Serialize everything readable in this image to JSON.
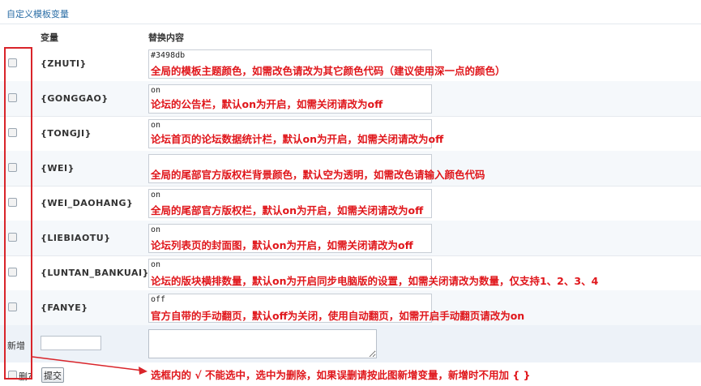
{
  "panel": {
    "title": "自定义模板变量",
    "col_variable": "变量",
    "col_replace": "替换内容"
  },
  "rows": [
    {
      "variable": "{ZHUTI}",
      "value": "#3498db",
      "note": "全局的模板主题颜色，如需改色请改为其它颜色代码（建议使用深一点的颜色）"
    },
    {
      "variable": "{GONGGAO}",
      "value": "on",
      "note": "论坛的公告栏，默认on为开启，如需关闭请改为off"
    },
    {
      "variable": "{TONGJI}",
      "value": "on",
      "note": "论坛首页的论坛数据统计栏，默认on为开启，如需关闭请改为off"
    },
    {
      "variable": "{WEI}",
      "value": "",
      "note": "全局的尾部官方版权栏背景颜色，默认空为透明，如需改色请输入颜色代码"
    },
    {
      "variable": "{WEI_DAOHANG}",
      "value": "on",
      "note": "全局的尾部官方版权栏，默认on为开启，如需关闭请改为off"
    },
    {
      "variable": "{LIEBIAOTU}",
      "value": "on",
      "note": "论坛列表页的封面图，默认on为开启，如需关闭请改为off"
    },
    {
      "variable": "{LUNTAN_BANKUAI}",
      "value": "on",
      "note": "论坛的版块横排数量，默认on为开启同步电脑版的设置，如需关闭请改为数量，仅支持1、2、3、4"
    },
    {
      "variable": "{FANYE}",
      "value": "off",
      "note": "官方自带的手动翻页，默认off为关闭，使用自动翻页，如需开启手动翻页请改为on"
    }
  ],
  "new_row": {
    "label": "新增",
    "variable_value": "",
    "replace_value": ""
  },
  "footer": {
    "delete_label": "删?",
    "submit_label": "提交",
    "instruction": "选框内的 √ 不能选中，选中为删除，如果误删请按此图新增变量，新增时不用加 { }"
  },
  "colors": {
    "annotation": "#e0161b",
    "title": "#2b6ea6"
  }
}
